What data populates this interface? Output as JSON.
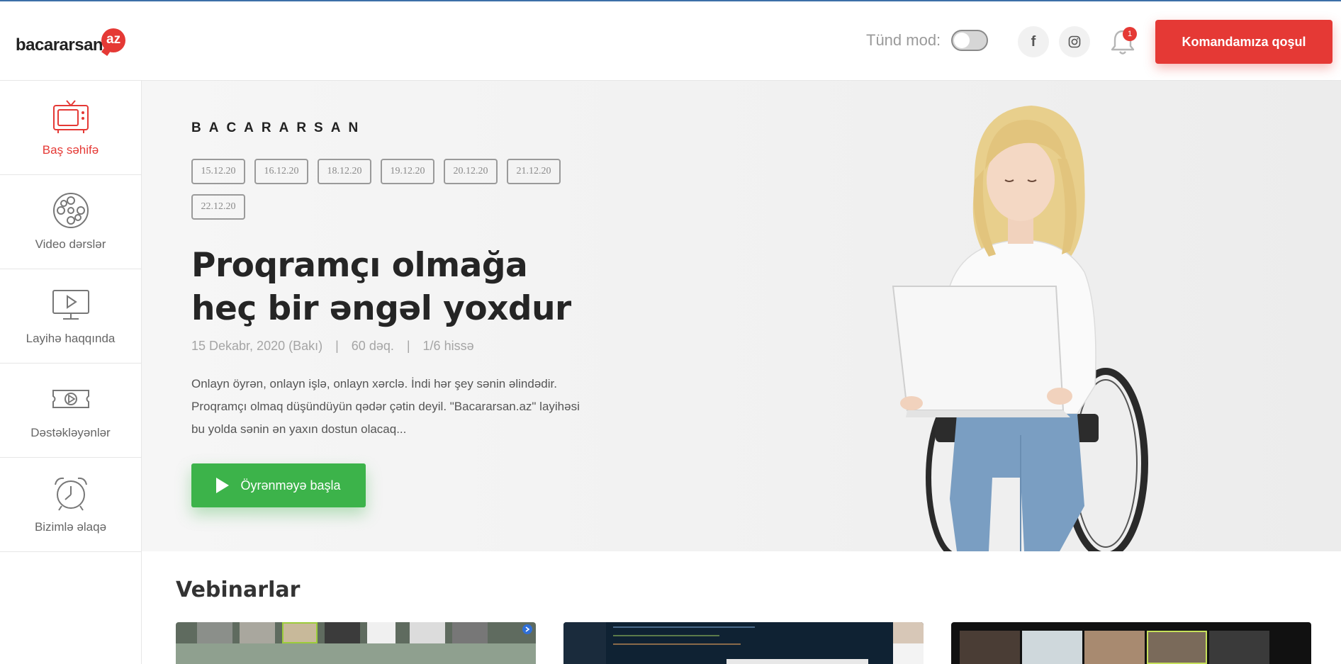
{
  "header": {
    "logo": {
      "name": "bacararsan",
      "badge": "az"
    },
    "dark_mode_label": "Tünd mod:",
    "dark_mode_on": false,
    "facebook_icon": "facebook-icon",
    "instagram_icon": "instagram-icon",
    "notification_count": "1",
    "join_button": "Komandamıza qoşul",
    "accent_color": "#e53935"
  },
  "sidebar": {
    "items": [
      {
        "label": "Baş səhifə",
        "icon": "tv-icon",
        "active": true
      },
      {
        "label": "Video dərslər",
        "icon": "film-reel-icon",
        "active": false
      },
      {
        "label": "Layihə haqqında",
        "icon": "monitor-play-icon",
        "active": false
      },
      {
        "label": "Dəstəkləyənlər",
        "icon": "ticket-play-icon",
        "active": false
      },
      {
        "label": "Bizimlə əlaqə",
        "icon": "alarm-clock-icon",
        "active": false
      }
    ]
  },
  "hero": {
    "eyebrow": "BACARARSAN",
    "dates": [
      "15.12.20",
      "16.12.20",
      "18.12.20",
      "19.12.20",
      "20.12.20",
      "21.12.20",
      "22.12.20"
    ],
    "title_line1": "Proqramçı olmağa",
    "title_line2": "heç bir əngəl yoxdur",
    "meta": {
      "date": "15 Dekabr, 2020 (Bakı)",
      "sep": "|",
      "duration": "60 dəq.",
      "part": "1/6 hissə"
    },
    "description": "Onlayn öyrən, onlayn işlə, onlayn xərclə. İndi hər şey sənin əlindədir. Proqramçı olmaq düşündüyün qədər çətin deyil. \"Bacararsan.az\" layihəsi bu yolda sənin ən yaxın dostun olacaq...",
    "start_button": "Öyrənməyə başla",
    "start_color": "#3cb34a"
  },
  "webinars": {
    "title": "Vebinarlar"
  }
}
